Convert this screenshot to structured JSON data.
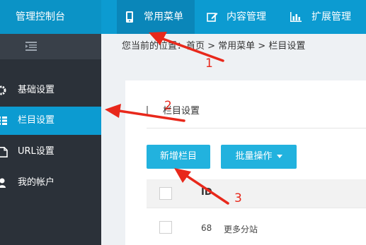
{
  "header": {
    "brand": "管理控制台",
    "nav": [
      {
        "label": "常用菜单",
        "icon": "mobile-icon"
      },
      {
        "label": "内容管理",
        "icon": "edit-icon"
      },
      {
        "label": "扩展管理",
        "icon": "bar-chart-icon"
      }
    ]
  },
  "sidebar": {
    "toggle_icon": "indent-icon",
    "items": [
      {
        "label": "基础设置",
        "icon": "gear-icon"
      },
      {
        "label": "栏目设置",
        "icon": "list-icon"
      },
      {
        "label": "URL设置",
        "icon": "file-icon"
      },
      {
        "label": "我的帐户",
        "icon": "user-icon"
      }
    ]
  },
  "breadcrumb": "您当前的位置：首页 > 常用菜单 > 栏目设置",
  "panel": {
    "title": "栏目设置",
    "add_button": "新增栏目",
    "batch_button": "批量操作"
  },
  "table": {
    "header_id": "ID",
    "rows": [
      {
        "id": "68",
        "name": "更多分站"
      }
    ]
  },
  "annotations": {
    "labels": [
      "1",
      "2",
      "3"
    ],
    "color": "#e8281b"
  },
  "colors": {
    "topbar": "#0c9bd1",
    "sidebar": "#2b3139",
    "button": "#22b2de"
  }
}
